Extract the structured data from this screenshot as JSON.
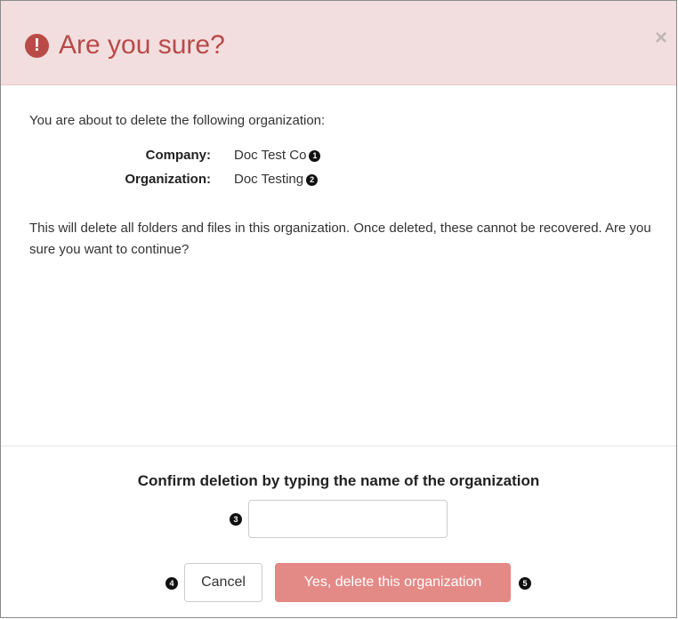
{
  "dialog": {
    "title": "Are you sure?",
    "header_icon": "exclamation-circle-icon",
    "close_label": "×",
    "colors": {
      "header_bg": "#f2dede",
      "title_color": "#b94a48",
      "delete_button_bg": "#e48a86"
    }
  },
  "body": {
    "intro": "You are about to delete the following organization:",
    "details": [
      {
        "label": "Company:",
        "value": "Doc Test Co",
        "callout": "1"
      },
      {
        "label": "Organization:",
        "value": "Doc Testing",
        "callout": "2"
      }
    ],
    "warning": "This will delete all folders and files in this organization. Once deleted, these cannot be recovered. Are you sure you want to continue?"
  },
  "footer": {
    "confirm_label": "Confirm deletion by typing the name of the organization",
    "input_value": "",
    "input_callout": "3",
    "cancel_label": "Cancel",
    "cancel_callout": "4",
    "delete_label": "Yes, delete this organization",
    "delete_callout": "5"
  }
}
